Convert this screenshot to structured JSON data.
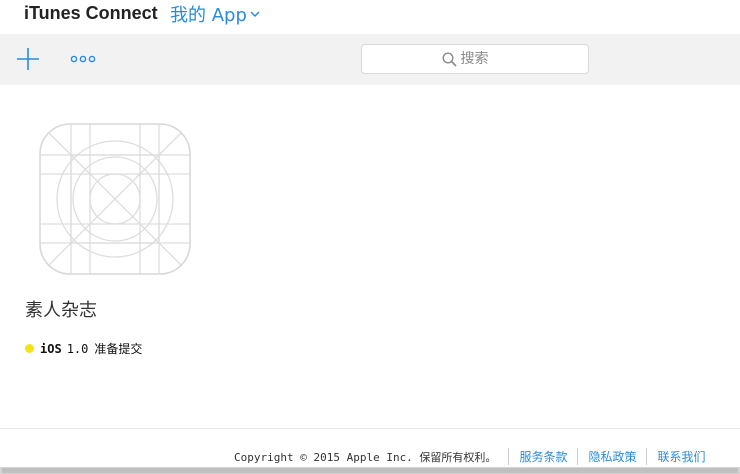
{
  "header": {
    "brand": "iTunes Connect",
    "menu_label": "我的 App"
  },
  "toolbar": {
    "add_icon": "plus-icon",
    "more_icon": "more-icon",
    "search_placeholder": "搜索"
  },
  "app": {
    "name": "素人杂志",
    "platform": "iOS",
    "version": "1.0",
    "status": "准备提交",
    "status_color": "#f5e315"
  },
  "footer": {
    "copyright": "Copyright © 2015 Apple Inc. 保留所有权利。",
    "links": [
      "服务条款",
      "隐私政策",
      "联系我们"
    ]
  },
  "colors": {
    "accent": "#2a8cd8",
    "toolbar_bg": "#f2f2f2"
  }
}
